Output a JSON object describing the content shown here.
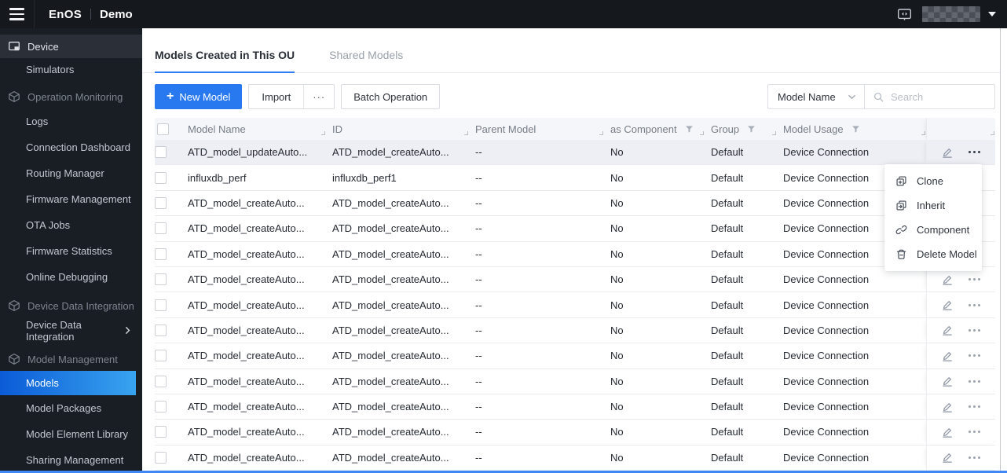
{
  "topbar": {
    "brand": "EnOS",
    "environment": "Demo"
  },
  "sidebar": {
    "items": [
      {
        "kind": "item",
        "label": "Device",
        "icon": "device-icon",
        "active": true
      },
      {
        "kind": "sub",
        "label": "Simulators"
      },
      {
        "kind": "section",
        "label": "Operation Monitoring",
        "icon": "cube-icon"
      },
      {
        "kind": "sub",
        "label": "Logs"
      },
      {
        "kind": "sub",
        "label": "Connection Dashboard"
      },
      {
        "kind": "sub",
        "label": "Routing Manager"
      },
      {
        "kind": "sub",
        "label": "Firmware Management"
      },
      {
        "kind": "sub",
        "label": "OTA Jobs"
      },
      {
        "kind": "sub",
        "label": "Firmware Statistics"
      },
      {
        "kind": "sub",
        "label": "Online Debugging"
      },
      {
        "kind": "section",
        "label": "Device Data Integration",
        "icon": "cube-icon"
      },
      {
        "kind": "sub",
        "label": "Device Data Integration",
        "chevron": true
      },
      {
        "kind": "section",
        "label": "Model Management",
        "icon": "cube-icon"
      },
      {
        "kind": "sub",
        "label": "Models",
        "selected": true
      },
      {
        "kind": "sub",
        "label": "Model Packages"
      },
      {
        "kind": "sub",
        "label": "Model Element Library"
      },
      {
        "kind": "sub",
        "label": "Sharing Management"
      }
    ]
  },
  "tabs": [
    {
      "label": "Models Created in This OU",
      "active": true
    },
    {
      "label": "Shared Models",
      "active": false
    }
  ],
  "toolbar": {
    "new_model_label": "New Model",
    "import_label": "Import",
    "more_label": "···",
    "batch_operation_label": "Batch Operation"
  },
  "search": {
    "filter_selected": "Model Name",
    "placeholder": "Search"
  },
  "table": {
    "columns": [
      {
        "label": "Model Name",
        "filter": false
      },
      {
        "label": "ID",
        "filter": false
      },
      {
        "label": "Parent Model",
        "filter": false
      },
      {
        "label": "as Component",
        "filter": true
      },
      {
        "label": "Group",
        "filter": true
      },
      {
        "label": "Model Usage",
        "filter": true
      }
    ],
    "rows": [
      {
        "model_name": "ATD_model_updateAuto...",
        "id": "ATD_model_createAuto...",
        "parent_model": "--",
        "as_component": "No",
        "group": "Default",
        "model_usage": "Device Connection",
        "highlighted": true
      },
      {
        "model_name": "influxdb_perf",
        "id": "influxdb_perf1",
        "parent_model": "--",
        "as_component": "No",
        "group": "Default",
        "model_usage": "Device Connection"
      },
      {
        "model_name": "ATD_model_createAuto...",
        "id": "ATD_model_createAuto...",
        "parent_model": "--",
        "as_component": "No",
        "group": "Default",
        "model_usage": "Device Connection"
      },
      {
        "model_name": "ATD_model_createAuto...",
        "id": "ATD_model_createAuto...",
        "parent_model": "--",
        "as_component": "No",
        "group": "Default",
        "model_usage": "Device Connection"
      },
      {
        "model_name": "ATD_model_createAuto...",
        "id": "ATD_model_createAuto...",
        "parent_model": "--",
        "as_component": "No",
        "group": "Default",
        "model_usage": "Device Connection"
      },
      {
        "model_name": "ATD_model_createAuto...",
        "id": "ATD_model_createAuto...",
        "parent_model": "--",
        "as_component": "No",
        "group": "Default",
        "model_usage": "Device Connection"
      },
      {
        "model_name": "ATD_model_createAuto...",
        "id": "ATD_model_createAuto...",
        "parent_model": "--",
        "as_component": "No",
        "group": "Default",
        "model_usage": "Device Connection"
      },
      {
        "model_name": "ATD_model_createAuto...",
        "id": "ATD_model_createAuto...",
        "parent_model": "--",
        "as_component": "No",
        "group": "Default",
        "model_usage": "Device Connection"
      },
      {
        "model_name": "ATD_model_createAuto...",
        "id": "ATD_model_createAuto...",
        "parent_model": "--",
        "as_component": "No",
        "group": "Default",
        "model_usage": "Device Connection"
      },
      {
        "model_name": "ATD_model_createAuto...",
        "id": "ATD_model_createAuto...",
        "parent_model": "--",
        "as_component": "No",
        "group": "Default",
        "model_usage": "Device Connection"
      },
      {
        "model_name": "ATD_model_createAuto...",
        "id": "ATD_model_createAuto...",
        "parent_model": "--",
        "as_component": "No",
        "group": "Default",
        "model_usage": "Device Connection"
      },
      {
        "model_name": "ATD_model_createAuto...",
        "id": "ATD_model_createAuto...",
        "parent_model": "--",
        "as_component": "No",
        "group": "Default",
        "model_usage": "Device Connection"
      },
      {
        "model_name": "ATD_model_createAuto...",
        "id": "ATD_model_createAuto...",
        "parent_model": "--",
        "as_component": "No",
        "group": "Default",
        "model_usage": "Device Connection"
      }
    ]
  },
  "context_menu": {
    "items": [
      {
        "icon": "clone-icon",
        "label": "Clone"
      },
      {
        "icon": "inherit-icon",
        "label": "Inherit"
      },
      {
        "icon": "component-icon",
        "label": "Component"
      },
      {
        "icon": "delete-icon",
        "label": "Delete Model"
      }
    ]
  },
  "colors": {
    "accent": "#2878f0",
    "tab_underline": "#2f7cf6",
    "sidebar_selected_gradient": [
      "#0b5bd7",
      "#38a4ef"
    ],
    "row_highlight": "#edeff5",
    "window_edge_bottom": "#3f87f5"
  }
}
